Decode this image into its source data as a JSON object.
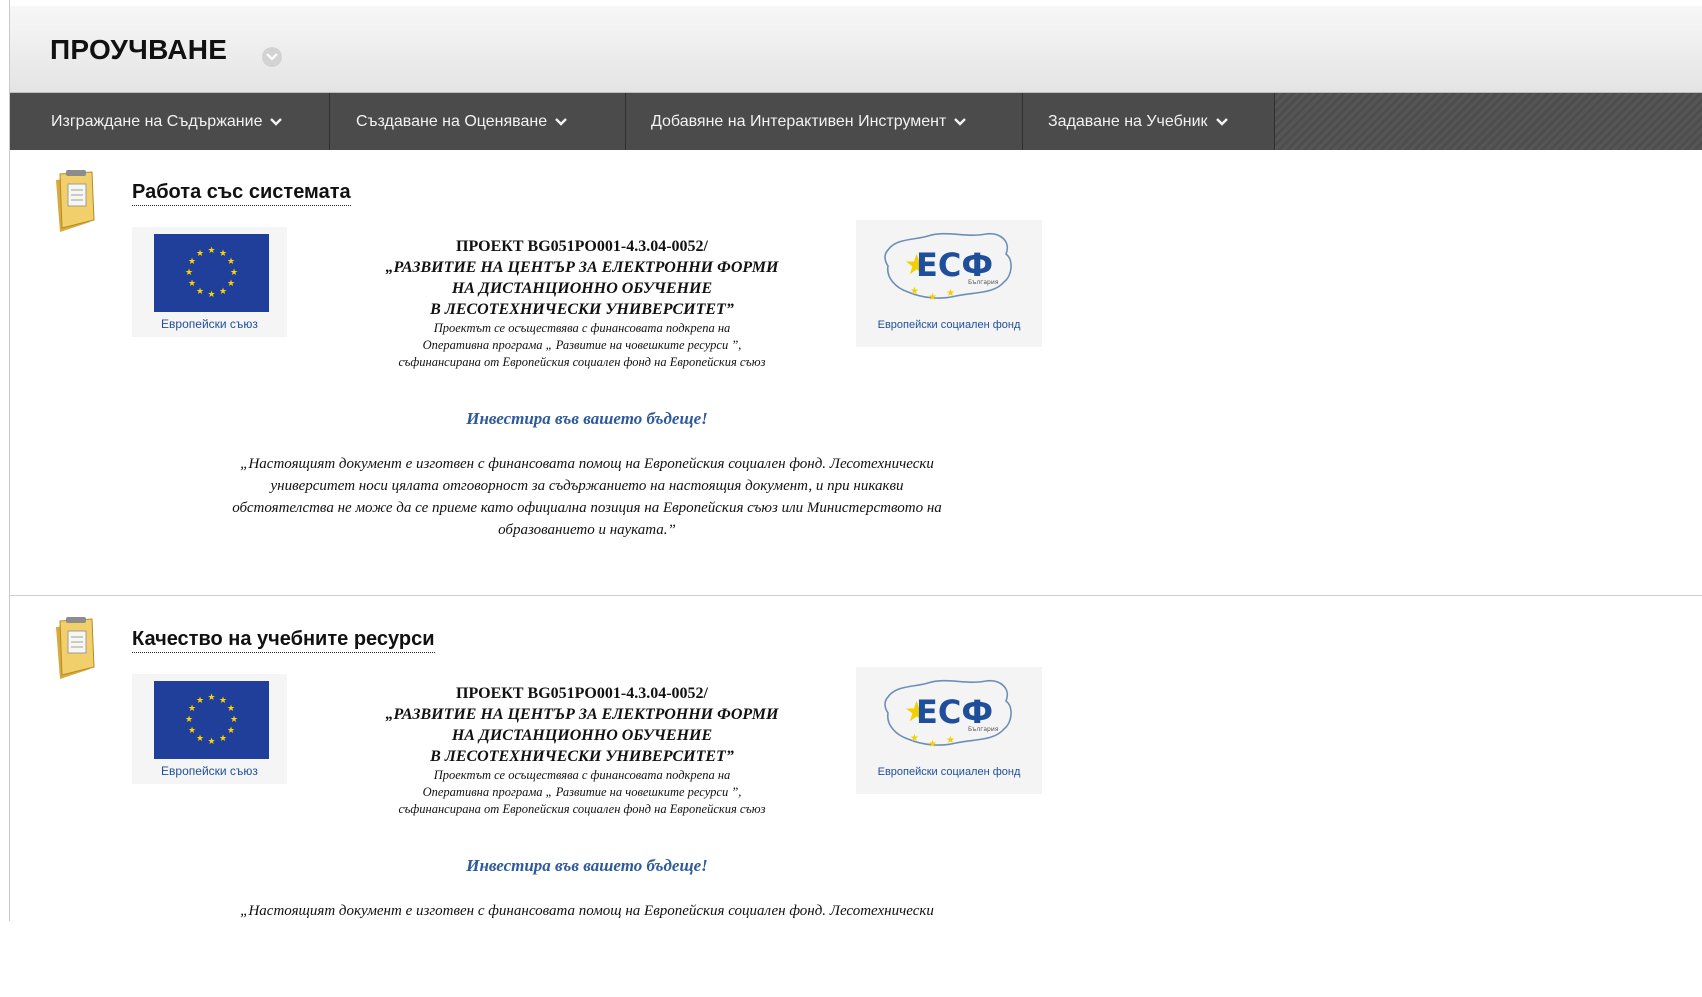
{
  "page": {
    "title": "ПРОУЧВАНЕ"
  },
  "action_bar": {
    "items": [
      {
        "label": "Изграждане на Съдържание"
      },
      {
        "label": "Създаване на Оценяване"
      },
      {
        "label": "Добавяне на Интерактивен Инструмент"
      },
      {
        "label": "Задаване на Учебник"
      }
    ]
  },
  "content_items": [
    {
      "title": "Работа със системата",
      "flyer": {
        "eu_label": "Европейски съюз",
        "esf_mark": "ЕСФ",
        "esf_country": "България",
        "esf_label": "Европейски социален фонд",
        "project_line1": "ПРОЕКТ BG051PO001-4.3.04-0052/",
        "project_line2": "„РАЗВИТИЕ НА ЦЕНТЪР ЗА ЕЛЕКТРОННИ ФОРМИ",
        "project_line3": "НА ДИСТАНЦИОННО ОБУЧЕНИЕ",
        "project_line4": "В ЛЕСОТЕХНИЧЕСКИ УНИВЕРСИТЕТ”",
        "support_line1": "Проектът се осъществява с финансовата подкрепа на",
        "support_line2": "Оперативна програма „ Развитие на човешките ресурси ”,",
        "support_line3": "съфинансирана от Европейския социален фонд на Европейския съюз",
        "invest": "Инвестира във вашето бъдеще!",
        "disclaimer_line1": "„Настоящият документ е изготвен с финансовата помощ на Европейския социален фонд. Лесотехнически",
        "disclaimer_line2": "университет носи цялата отговорност за съдържанието на настоящия документ, и при никакви",
        "disclaimer_line3": "обстоятелства не може да се приеме като официална позиция на Европейския съюз или Министерството на",
        "disclaimer_line4": "образованието и науката.”"
      }
    },
    {
      "title": "Качество на учебните ресурси",
      "flyer": {
        "eu_label": "Европейски съюз",
        "esf_mark": "ЕСФ",
        "esf_country": "България",
        "esf_label": "Европейски социален фонд",
        "project_line1": "ПРОЕКТ BG051PO001-4.3.04-0052/",
        "project_line2": "„РАЗВИТИЕ НА ЦЕНТЪР ЗА ЕЛЕКТРОННИ ФОРМИ",
        "project_line3": "НА ДИСТАНЦИОННО ОБУЧЕНИЕ",
        "project_line4": "В ЛЕСОТЕХНИЧЕСКИ УНИВЕРСИТЕТ”",
        "support_line1": "Проектът се осъществява с финансовата подкрепа на",
        "support_line2": "Оперативна програма „ Развитие на човешките ресурси ”,",
        "support_line3": "съфинансирана от Европейския социален фонд на Европейския съюз",
        "invest": "Инвестира във вашето бъдеще!",
        "disclaimer_line1": "„Настоящият документ е изготвен с финансовата помощ на Европейския социален фонд. Лесотехнически"
      }
    }
  ],
  "colors": {
    "action_bar": "#4b4b4b",
    "eu_blue": "#1f3f9a",
    "invest_blue": "#2e5a9c",
    "folder_yellow": "#e8c25a"
  }
}
